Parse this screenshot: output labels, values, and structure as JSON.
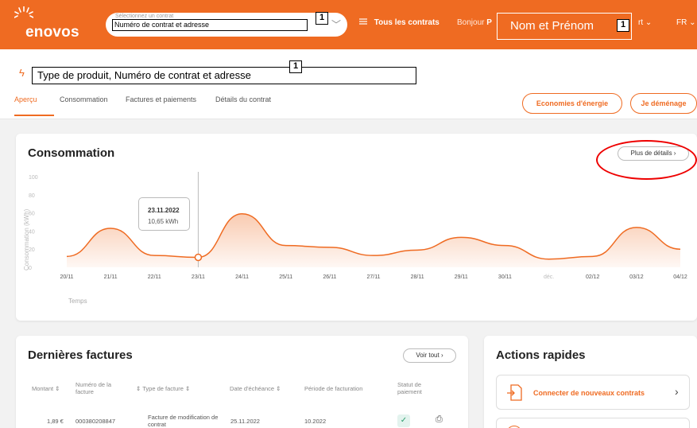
{
  "header": {
    "logo": "enovos",
    "contract_selector_label": "Sélectionnez un contrat",
    "contract_selector_value": "Numéro de contrat et adresse",
    "badge": "1",
    "all_contracts": "Tous les contrats",
    "greeting": "Bonjour",
    "greeting_initial": "P",
    "user_name": "Nom et Prénom",
    "account_suffix": "rt",
    "language": "FR"
  },
  "product": {
    "title": "Type de produit, Numéro de contrat et adresse"
  },
  "tabs": [
    "Aperçu",
    "Consommation",
    "Factures et paiements",
    "Détails du contrat"
  ],
  "actions_top": {
    "savings": "Economies d'énergie",
    "move": "Je déménage"
  },
  "consumption": {
    "title": "Consommation",
    "more": "Plus de détails  ›",
    "tooltip_date": "23.11.2022",
    "tooltip_value": "10,65 kWh"
  },
  "chart_data": {
    "type": "area",
    "title": "Consommation",
    "ylabel": "Consommation (kWh)",
    "xlabel": "Temps",
    "ylim": [
      0,
      100
    ],
    "yticks": [
      0,
      20,
      40,
      60,
      80,
      100
    ],
    "x": [
      "20/11",
      "21/11",
      "22/11",
      "23/11",
      "24/11",
      "25/11",
      "26/11",
      "27/11",
      "28/11",
      "29/11",
      "30/11",
      "déc.",
      "02/12",
      "03/12",
      "04/12"
    ],
    "series": [
      {
        "values": [
          12,
          43,
          13,
          11,
          59,
          24,
          22,
          13,
          19,
          33,
          24,
          9,
          12,
          44,
          20
        ]
      }
    ],
    "color": "#ef6b22"
  },
  "invoices": {
    "title": "Dernières factures",
    "see_all": "Voir tout  ›",
    "columns": [
      "Montant ⇕",
      "Numéro de la facture",
      "⇕  Type de facture ⇕",
      "Date d'échéance ⇕",
      "Période de facturation",
      "Statut de paiement"
    ],
    "rows": [
      {
        "amount": "1,89 €",
        "number": "000380208847",
        "type": "Facture de modification de contrat",
        "due": "25.11.2022",
        "period": "10.2022",
        "status_icon": "check-icon"
      }
    ]
  },
  "quick_actions": {
    "title": "Actions rapides",
    "items": [
      {
        "label": "Connecter de nouveaux contrats",
        "icon": "document-plus-icon"
      }
    ]
  }
}
